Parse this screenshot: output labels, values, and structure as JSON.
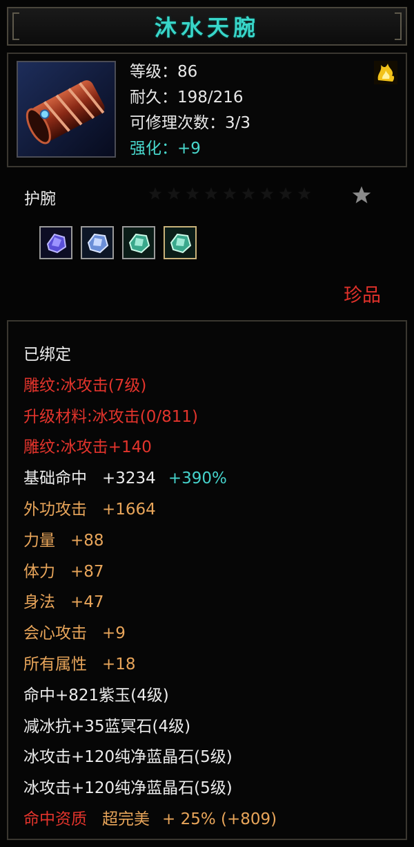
{
  "item": {
    "title": "沐水天腕",
    "level": "等级：86",
    "durability": "耐久：198/216",
    "repair": "可修理次数：3/3",
    "enhance": "强化：+9",
    "type": "护腕",
    "quality": "珍品"
  },
  "gems": [
    {
      "icon": "purple-gem-icon"
    },
    {
      "icon": "blue-gem-icon"
    },
    {
      "icon": "green-gem-icon"
    },
    {
      "icon": "green-gem-icon"
    }
  ],
  "attributes": {
    "bound": "已绑定",
    "engrave": "雕纹:冰攻击(7级)",
    "material": "升级材料:冰攻击(0/811)",
    "engrave_bonus": "雕纹:冰攻击+140",
    "hit": {
      "label": "基础命中",
      "value": "+3234",
      "pct": "+390%"
    },
    "outer_attack": {
      "label": "外功攻击",
      "value": "+1664"
    },
    "strength": {
      "label": "力量",
      "value": "+88"
    },
    "stamina": {
      "label": "体力",
      "value": "+87"
    },
    "agility": {
      "label": "身法",
      "value": "+47"
    },
    "crit": {
      "label": "会心攻击",
      "value": "+9"
    },
    "all_attr": {
      "label": "所有属性",
      "value": "+18"
    },
    "gem_lines": [
      "命中+821紫玉(4级)",
      "减冰抗+35蓝冥石(4级)",
      "冰攻击+120纯净蓝晶石(5级)",
      "冰攻击+120纯净蓝晶石(5级)"
    ],
    "aptitude": {
      "label": "命中资质",
      "grade": "超完美",
      "value": "+ 25%  (+809)"
    }
  },
  "colors": {
    "title": "#38d6c9",
    "red": "#e3342c",
    "orange": "#e8a55a",
    "cyan": "#45d2cb"
  }
}
